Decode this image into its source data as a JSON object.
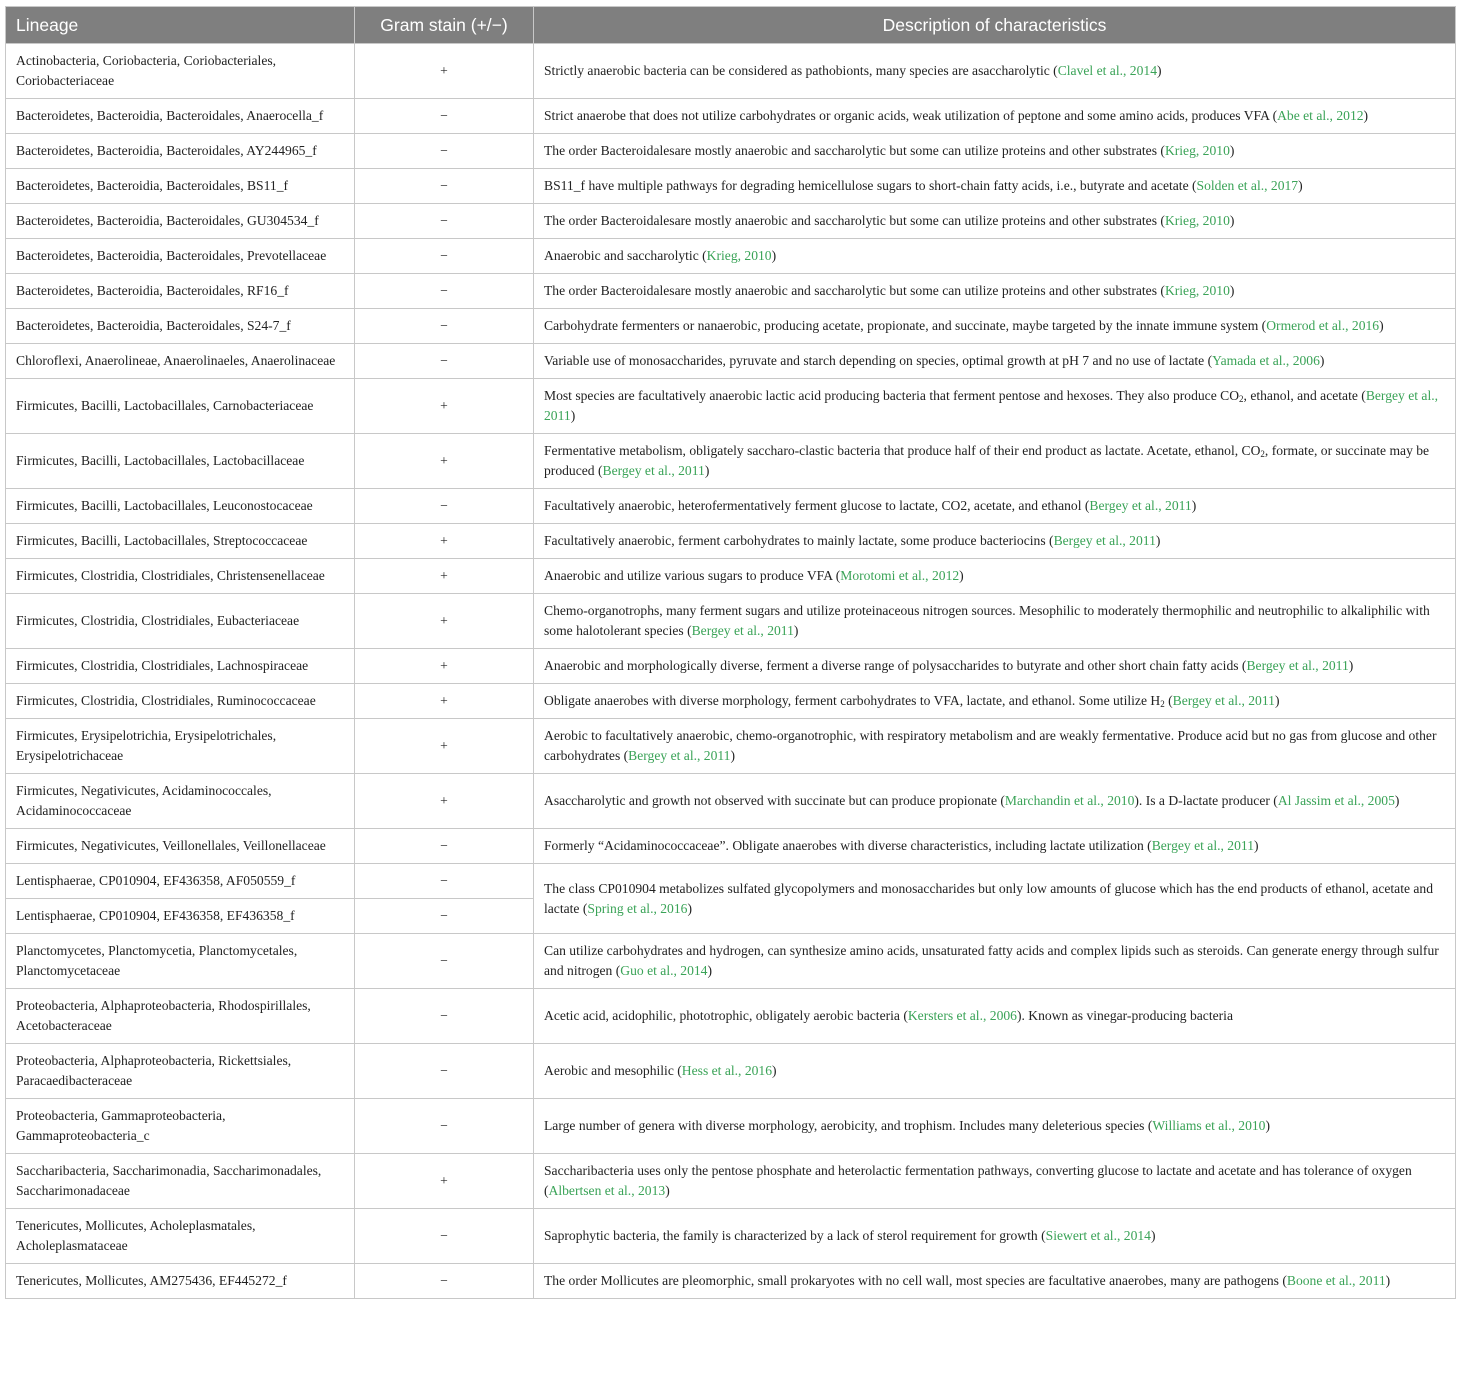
{
  "headers": {
    "lineage": "Lineage",
    "gram": "Gram stain (+/−)",
    "description": "Description of characteristics"
  },
  "rows": [
    {
      "lineage": "Actinobacteria, Coriobacteria, Coriobacteriales, Coriobacteriaceae",
      "gram": "+",
      "desc": [
        [
          "Strictly anaerobic bacteria can be considered as pathobionts, many species are asaccharolytic ("
        ],
        [
          "Clavel et al., 2014",
          "ref"
        ],
        [
          ")"
        ]
      ]
    },
    {
      "lineage": "Bacteroidetes, Bacteroidia, Bacteroidales, Anaerocella_f",
      "gram": "−",
      "desc": [
        [
          "Strict anaerobe that does not utilize carbohydrates or organic acids, weak utilization of peptone and some amino acids, produces VFA ("
        ],
        [
          "Abe et al., 2012",
          "ref"
        ],
        [
          ")"
        ]
      ]
    },
    {
      "lineage": "Bacteroidetes, Bacteroidia, Bacteroidales, AY244965_f",
      "gram": "−",
      "desc": [
        [
          "The order Bacteroidalesare mostly anaerobic and saccharolytic but some can utilize proteins and other substrates ("
        ],
        [
          "Krieg, 2010",
          "ref"
        ],
        [
          ")"
        ]
      ]
    },
    {
      "lineage": "Bacteroidetes, Bacteroidia, Bacteroidales, BS11_f",
      "gram": "−",
      "desc": [
        [
          "BS11_f have multiple pathways for degrading hemicellulose sugars to short-chain fatty acids, i.e., butyrate and acetate ("
        ],
        [
          "Solden et al., 2017",
          "ref"
        ],
        [
          ")"
        ]
      ]
    },
    {
      "lineage": "Bacteroidetes, Bacteroidia, Bacteroidales, GU304534_f",
      "gram": "−",
      "desc": [
        [
          "The order Bacteroidalesare mostly anaerobic and saccharolytic but some can utilize proteins and other substrates ("
        ],
        [
          "Krieg, 2010",
          "ref"
        ],
        [
          ")"
        ]
      ]
    },
    {
      "lineage": "Bacteroidetes, Bacteroidia, Bacteroidales, Prevotellaceae",
      "gram": "−",
      "desc": [
        [
          "Anaerobic and saccharolytic ("
        ],
        [
          "Krieg, 2010",
          "ref"
        ],
        [
          ")"
        ]
      ]
    },
    {
      "lineage": "Bacteroidetes, Bacteroidia, Bacteroidales, RF16_f",
      "gram": "−",
      "desc": [
        [
          "The order Bacteroidalesare mostly anaerobic and saccharolytic but some can utilize proteins and other substrates ("
        ],
        [
          "Krieg, 2010",
          "ref"
        ],
        [
          ")"
        ]
      ]
    },
    {
      "lineage": "Bacteroidetes, Bacteroidia, Bacteroidales, S24-7_f",
      "gram": "−",
      "desc": [
        [
          "Carbohydrate fermenters or nanaerobic, producing acetate, propionate, and succinate, maybe targeted by the innate immune system ("
        ],
        [
          "Ormerod et al., 2016",
          "ref"
        ],
        [
          ")"
        ]
      ]
    },
    {
      "lineage": "Chloroflexi, Anaerolineae, Anaerolinaeles, Anaerolinaceae",
      "gram": "−",
      "desc": [
        [
          "Variable use of monosaccharides, pyruvate and starch depending on species, optimal growth at pH 7 and no use of lactate ("
        ],
        [
          "Yamada et al., 2006",
          "ref"
        ],
        [
          ")"
        ]
      ]
    },
    {
      "lineage": "Firmicutes, Bacilli, Lactobacillales, Carnobacteriaceae",
      "gram": "+",
      "desc": [
        [
          "Most species are facultatively anaerobic lactic acid producing bacteria that ferment pentose and hexoses. They also produce CO"
        ],
        [
          "2",
          "sub"
        ],
        [
          ", ethanol, and acetate ("
        ],
        [
          "Bergey et al., 2011",
          "ref"
        ],
        [
          ")"
        ]
      ]
    },
    {
      "lineage": "Firmicutes, Bacilli, Lactobacillales, Lactobacillaceae",
      "gram": "+",
      "desc": [
        [
          "Fermentative metabolism, obligately saccharo-clastic bacteria that produce half of their end product as lactate. Acetate, ethanol, CO"
        ],
        [
          "2",
          "sub"
        ],
        [
          ", formate, or succinate may be produced ("
        ],
        [
          "Bergey et al., 2011",
          "ref"
        ],
        [
          ")"
        ]
      ]
    },
    {
      "lineage": "Firmicutes, Bacilli, Lactobacillales, Leuconostocaceae",
      "gram": "−",
      "desc": [
        [
          "Facultatively anaerobic, heterofermentatively ferment glucose to lactate, CO2, acetate, and ethanol ("
        ],
        [
          "Bergey et al., 2011",
          "ref"
        ],
        [
          ")"
        ]
      ]
    },
    {
      "lineage": "Firmicutes, Bacilli, Lactobacillales, Streptococcaceae",
      "gram": "+",
      "desc": [
        [
          "Facultatively anaerobic, ferment carbohydrates to mainly lactate, some produce bacteriocins ("
        ],
        [
          "Bergey et al., 2011",
          "ref"
        ],
        [
          ")"
        ]
      ]
    },
    {
      "lineage": "Firmicutes, Clostridia, Clostridiales, Christensenellaceae",
      "gram": "+",
      "desc": [
        [
          "Anaerobic and utilize various sugars to produce VFA ("
        ],
        [
          "Morotomi et al., 2012",
          "ref"
        ],
        [
          ")"
        ]
      ]
    },
    {
      "lineage": "Firmicutes, Clostridia, Clostridiales, Eubacteriaceae",
      "gram": "+",
      "desc": [
        [
          "Chemo-organotrophs, many ferment sugars and utilize proteinaceous nitrogen sources. Mesophilic to moderately thermophilic and neutrophilic to alkaliphilic with some halotolerant species ("
        ],
        [
          "Bergey et al., 2011",
          "ref"
        ],
        [
          ")"
        ]
      ]
    },
    {
      "lineage": "Firmicutes, Clostridia, Clostridiales, Lachnospiraceae",
      "gram": "+",
      "desc": [
        [
          "Anaerobic and morphologically diverse, ferment a diverse range of polysaccharides to butyrate and other short chain fatty acids ("
        ],
        [
          "Bergey et al., 2011",
          "ref"
        ],
        [
          ")"
        ]
      ]
    },
    {
      "lineage": "Firmicutes, Clostridia, Clostridiales, Ruminococcaceae",
      "gram": "+",
      "desc": [
        [
          "Obligate anaerobes with diverse morphology, ferment carbohydrates to VFA, lactate, and ethanol. Some utilize H"
        ],
        [
          "2",
          "sub"
        ],
        [
          " ("
        ],
        [
          "Bergey et al., 2011",
          "ref"
        ],
        [
          ")"
        ]
      ]
    },
    {
      "lineage": "Firmicutes, Erysipelotrichia, Erysipelotrichales, Erysipelotrichaceae",
      "gram": "+",
      "desc": [
        [
          "Aerobic to facultatively anaerobic, chemo-organotrophic, with respiratory metabolism and are weakly fermentative. Produce acid but no gas from glucose and other carbohydrates ("
        ],
        [
          "Bergey et al., 2011",
          "ref"
        ],
        [
          ")"
        ]
      ]
    },
    {
      "lineage": "Firmicutes, Negativicutes, Acidaminococcales, Acidaminococcaceae",
      "gram": "+",
      "desc": [
        [
          "Asaccharolytic and growth not observed with succinate but can produce propionate ("
        ],
        [
          "Marchandin et al., 2010",
          "ref"
        ],
        [
          "). Is a D-lactate producer ("
        ],
        [
          "Al Jassim et al., 2005",
          "ref"
        ],
        [
          ")"
        ]
      ]
    },
    {
      "lineage": "Firmicutes, Negativicutes, Veillonellales, Veillonellaceae",
      "gram": "−",
      "desc": [
        [
          "Formerly “Acidaminococcaceae”. Obligate anaerobes with diverse characteristics, including lactate utilization ("
        ],
        [
          "Bergey et al., 2011",
          "ref"
        ],
        [
          ")"
        ]
      ]
    },
    {
      "lineage": "Lentisphaerae, CP010904, EF436358, AF050559_f",
      "gram": "−",
      "desc": [
        [
          "The class CP010904 metabolizes sulfated glycopolymers and monosaccharides but only low amounts of glucose which has the end products of ethanol, acetate and lactate ("
        ],
        [
          "Spring et al., 2016",
          "ref"
        ],
        [
          ")"
        ]
      ],
      "rowspan": 2
    },
    {
      "lineage": "Lentisphaerae, CP010904, EF436358, EF436358_f",
      "gram": "−",
      "merged": true
    },
    {
      "lineage": "Planctomycetes, Planctomycetia, Planctomycetales, Planctomycetaceae",
      "gram": "−",
      "desc": [
        [
          "Can utilize carbohydrates and hydrogen, can synthesize amino acids, unsaturated fatty acids and complex lipids such as steroids. Can generate energy through sulfur and nitrogen ("
        ],
        [
          "Guo et al., 2014",
          "ref"
        ],
        [
          ")"
        ]
      ]
    },
    {
      "lineage": "Proteobacteria, Alphaproteobacteria, Rhodospirillales, Acetobacteraceae",
      "gram": "−",
      "desc": [
        [
          "Acetic acid, acidophilic, phototrophic, obligately aerobic bacteria ("
        ],
        [
          "Kersters et al., 2006",
          "ref"
        ],
        [
          "). Known as vinegar-producing bacteria"
        ]
      ]
    },
    {
      "lineage": "Proteobacteria, Alphaproteobacteria, Rickettsiales, Paracaedibacteraceae",
      "gram": "−",
      "desc": [
        [
          "Aerobic and mesophilic ("
        ],
        [
          "Hess et al., 2016",
          "ref"
        ],
        [
          ")"
        ]
      ]
    },
    {
      "lineage": "Proteobacteria, Gammaproteobacteria, Gammaproteobacteria_c",
      "gram": "−",
      "desc": [
        [
          "Large number of genera with diverse morphology, aerobicity, and trophism. Includes many deleterious species ("
        ],
        [
          "Williams et al., 2010",
          "ref"
        ],
        [
          ")"
        ]
      ]
    },
    {
      "lineage": "Saccharibacteria, Saccharimonadia, Saccharimonadales, Saccharimonadaceae",
      "gram": "+",
      "desc": [
        [
          "Saccharibacteria uses only the pentose phosphate and heterolactic fermentation pathways, converting glucose to lactate and acetate and has tolerance of oxygen ("
        ],
        [
          "Albertsen et al., 2013",
          "ref"
        ],
        [
          ")"
        ]
      ]
    },
    {
      "lineage": "Tenericutes, Mollicutes, Acholeplasmatales, Acholeplasmataceae",
      "gram": "−",
      "desc": [
        [
          "Saprophytic bacteria, the family is characterized by a lack of sterol requirement for growth ("
        ],
        [
          "Siewert et al., 2014",
          "ref"
        ],
        [
          ")"
        ]
      ]
    },
    {
      "lineage": "Tenericutes, Mollicutes, AM275436, EF445272_f",
      "gram": "−",
      "desc": [
        [
          "The order Mollicutes are pleomorphic, small prokaryotes with no cell wall, most species are facultative anaerobes, many are pathogens ("
        ],
        [
          "Boone et al., 2011",
          "ref"
        ],
        [
          ")"
        ]
      ]
    }
  ]
}
